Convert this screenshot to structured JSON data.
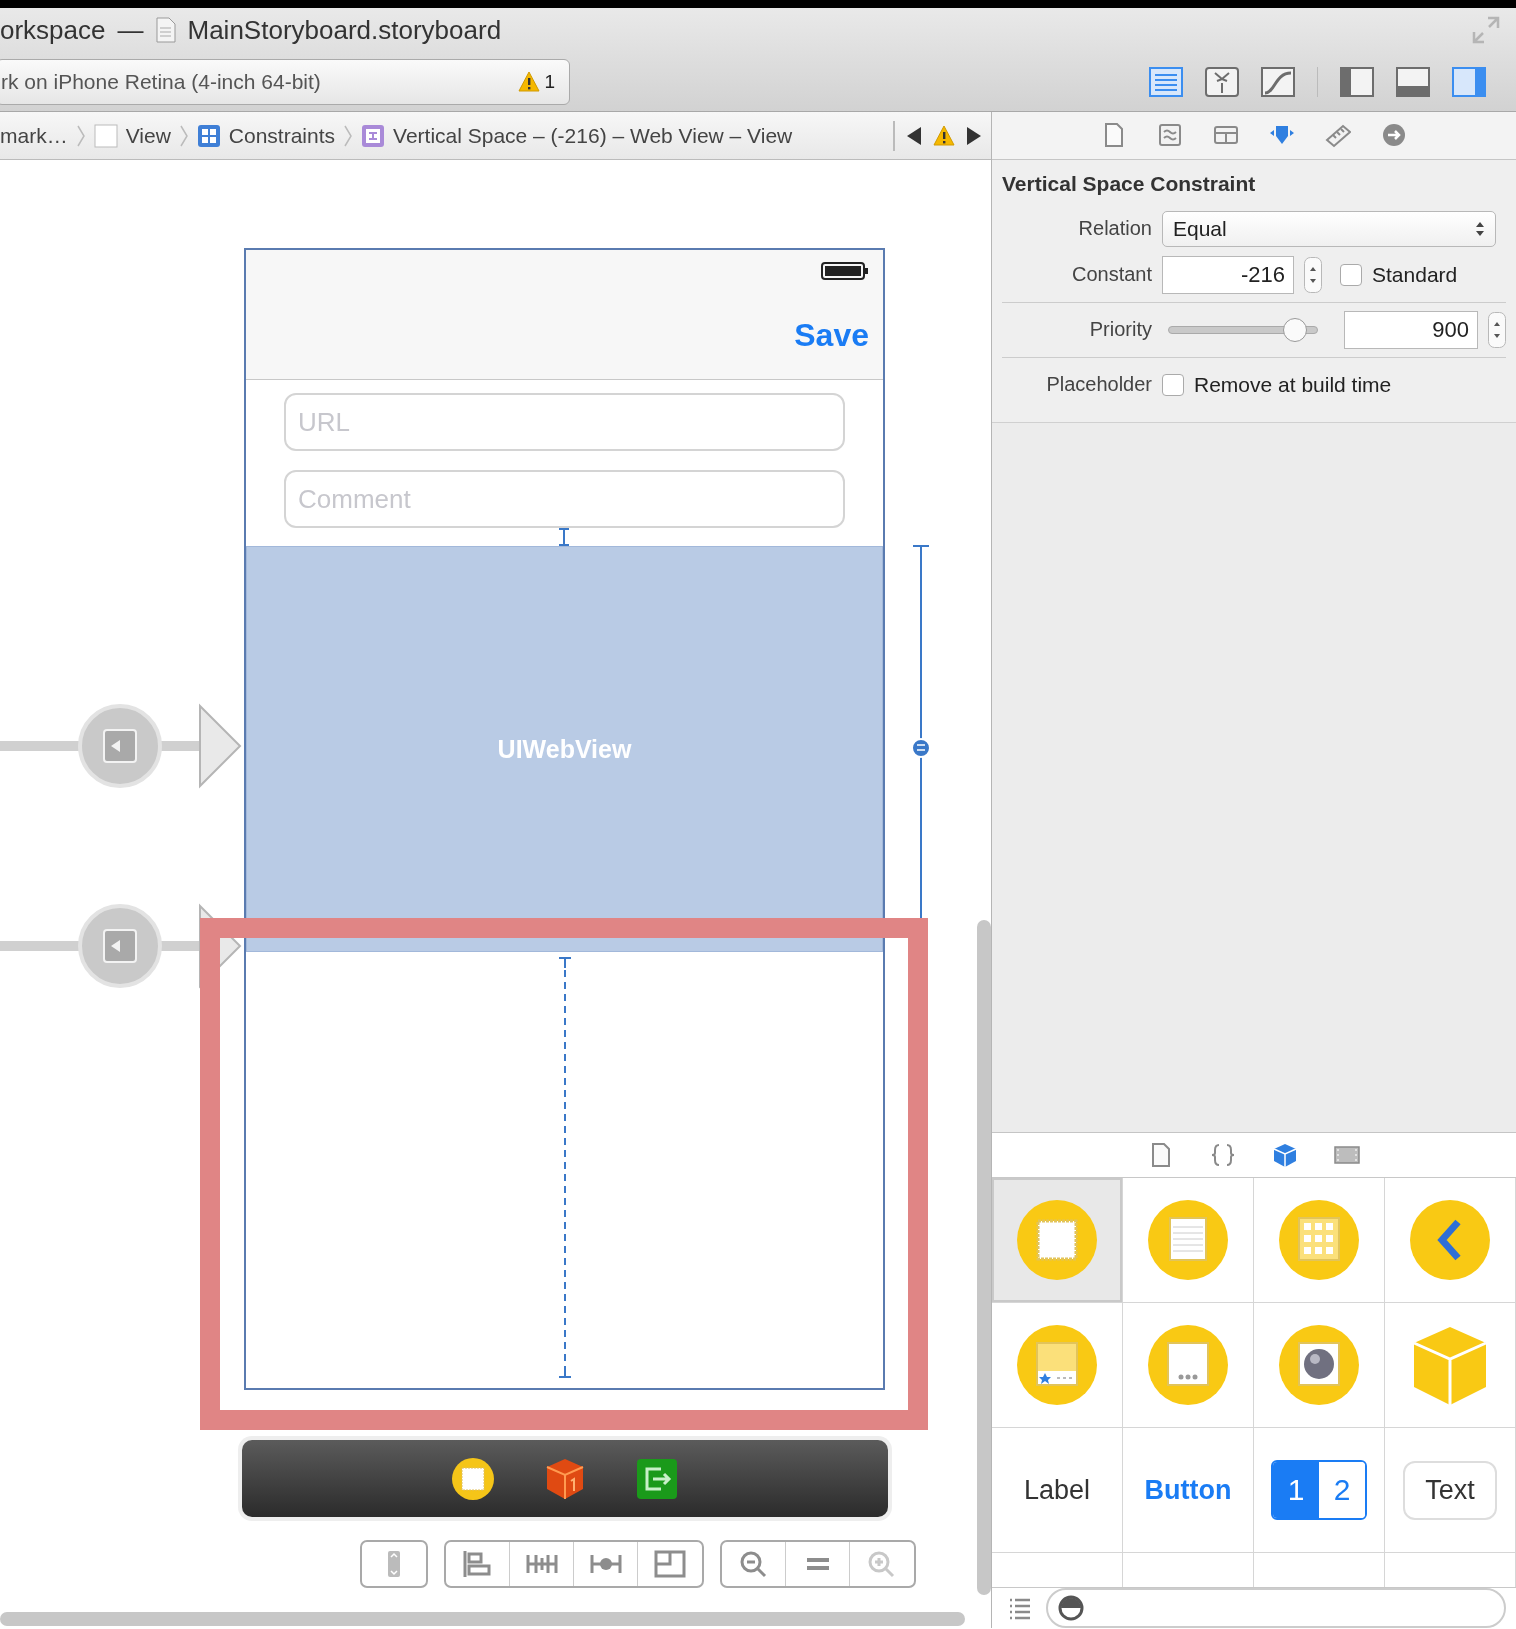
{
  "title_bar": {
    "workspace": "orkspace",
    "separator": "—",
    "document": "MainStoryboard.storyboard"
  },
  "scheme": {
    "label": "rk on iPhone Retina (4-inch 64-bit)",
    "warnings": "1"
  },
  "editor_buttons": [
    {
      "kind": "standard",
      "selected": true
    },
    {
      "kind": "assistant",
      "selected": false
    },
    {
      "kind": "version",
      "selected": false
    }
  ],
  "view_toggles": [
    {
      "kind": "navigator",
      "selected": false
    },
    {
      "kind": "debug",
      "selected": false
    },
    {
      "kind": "utilities",
      "selected": true
    }
  ],
  "breadcrumbs": [
    {
      "kind": "plain",
      "label": "mark…"
    },
    {
      "kind": "view",
      "label": "View"
    },
    {
      "kind": "constraints",
      "label": "Constraints"
    },
    {
      "kind": "constraint",
      "label": "Vertical Space – (-216) – Web View – View"
    }
  ],
  "inspector_tabs": [
    {
      "kind": "file",
      "selected": false
    },
    {
      "kind": "help",
      "selected": false
    },
    {
      "kind": "identity",
      "selected": false
    },
    {
      "kind": "attributes",
      "selected": true
    },
    {
      "kind": "size",
      "selected": false
    },
    {
      "kind": "connections",
      "selected": false
    }
  ],
  "inspector": {
    "title": "Vertical Space Constraint",
    "relation": {
      "label": "Relation",
      "value": "Equal"
    },
    "constant": {
      "label": "Constant",
      "value": "-216",
      "option": "Standard",
      "checked": false
    },
    "priority": {
      "label": "Priority",
      "level": 0.85,
      "value": "900"
    },
    "placeholder": {
      "label": "Placeholder",
      "option": "Remove at build time",
      "checked": false
    }
  },
  "canvas": {
    "save": "Save",
    "fields": [
      {
        "placeholder": "URL"
      },
      {
        "placeholder": "Comment"
      }
    ],
    "web_view": "UIWebView"
  },
  "library_tabs": [
    {
      "kind": "file",
      "selected": false
    },
    {
      "kind": "code",
      "selected": false
    },
    {
      "kind": "object",
      "selected": true
    },
    {
      "kind": "media",
      "selected": false
    }
  ],
  "library_items": [
    {
      "kind": "view",
      "selected": true
    },
    {
      "kind": "table",
      "selected": false
    },
    {
      "kind": "collection",
      "selected": false
    },
    {
      "kind": "navigation",
      "selected": false
    },
    {
      "kind": "tabbar",
      "selected": false
    },
    {
      "kind": "page",
      "selected": false
    },
    {
      "kind": "glkit",
      "selected": false
    },
    {
      "kind": "object",
      "selected": false
    },
    {
      "kind": "label",
      "selected": false,
      "text": "Label"
    },
    {
      "kind": "button",
      "selected": false,
      "text": "Button"
    },
    {
      "kind": "segmented",
      "selected": false,
      "segments": [
        {
          "text": "1",
          "selected": true
        },
        {
          "text": "2",
          "selected": false
        }
      ]
    },
    {
      "kind": "textfield",
      "selected": false,
      "text": "Text"
    }
  ]
}
